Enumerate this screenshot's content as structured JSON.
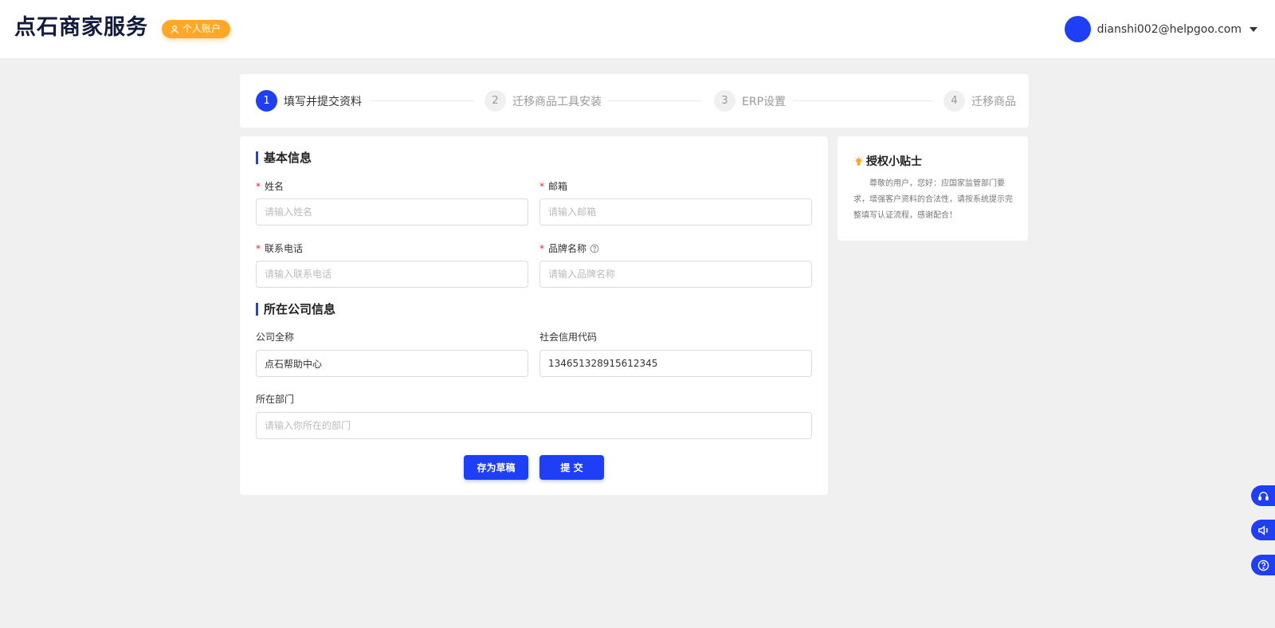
{
  "header": {
    "logo": "点石商家服务",
    "account_badge": "个人账户",
    "user_email": "dianshi002@helpgoo.com"
  },
  "steps": [
    {
      "num": "1",
      "label": "填写并提交资料",
      "active": true
    },
    {
      "num": "2",
      "label": "迁移商品工具安装",
      "active": false
    },
    {
      "num": "3",
      "label": "ERP设置",
      "active": false
    },
    {
      "num": "4",
      "label": "迁移商品",
      "active": false
    }
  ],
  "form": {
    "basic_title": "基本信息",
    "company_title": "所在公司信息",
    "fields": {
      "name": {
        "label": "姓名",
        "required": true,
        "value": "",
        "placeholder": "请输入姓名"
      },
      "email": {
        "label": "邮箱",
        "required": true,
        "value": "",
        "placeholder": "请输入邮箱"
      },
      "phone": {
        "label": "联系电话",
        "required": true,
        "value": "",
        "placeholder": "请输入联系电话"
      },
      "brand": {
        "label": "品牌名称",
        "required": true,
        "value": "",
        "placeholder": "请输入品牌名称"
      },
      "company": {
        "label": "公司全称",
        "required": false,
        "value": "点石帮助中心",
        "placeholder": ""
      },
      "credit_code": {
        "label": "社会信用代码",
        "required": false,
        "value": "134651328915612345",
        "placeholder": ""
      },
      "department": {
        "label": "所在部门",
        "required": false,
        "value": "",
        "placeholder": "请输入你所在的部门"
      }
    },
    "required_mark": "*",
    "save_draft_label": "存为草稿",
    "submit_label": "提 交"
  },
  "tips": {
    "title": "授权小贴士",
    "text": "尊敬的用户，您好：应国家监管部门要求，增强客户资料的合法性，请按系统提示完整填写认证流程，感谢配合！"
  },
  "colors": {
    "accent": "#1e3ff5",
    "badge": "#ffa726",
    "required": "#f5222d",
    "page_bg": "#f0f0f0"
  },
  "float_tools": [
    "headset-icon",
    "speaker-icon",
    "help-circle-icon"
  ]
}
